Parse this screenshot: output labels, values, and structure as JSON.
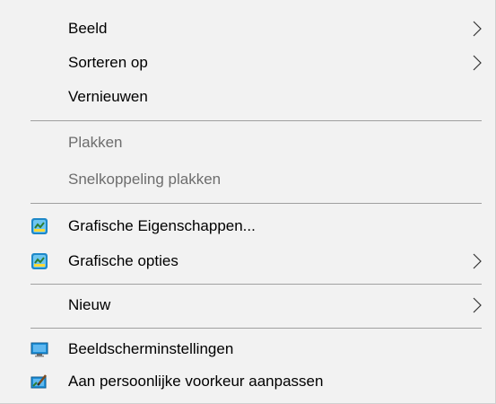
{
  "menu": {
    "group1": {
      "view": "Beeld",
      "sort_by": "Sorteren op",
      "refresh": "Vernieuwen"
    },
    "group2": {
      "paste": "Plakken",
      "paste_shortcut": "Snelkoppeling plakken"
    },
    "group3": {
      "graphics_properties": "Grafische Eigenschappen...",
      "graphics_options": "Grafische opties"
    },
    "group4": {
      "new": "Nieuw"
    },
    "group5": {
      "display_settings": "Beeldscherminstellingen",
      "personalize": "Aan persoonlijke voorkeur aanpassen"
    }
  },
  "icons": {
    "graphics_properties": "intel-graphics-icon",
    "graphics_options": "intel-graphics-icon",
    "display_settings": "monitor-icon",
    "personalize": "personalize-icon"
  },
  "colors": {
    "menu_background": "#f2f2f2",
    "disabled_text": "#6d6d6d",
    "separator": "#a0a0a0"
  }
}
